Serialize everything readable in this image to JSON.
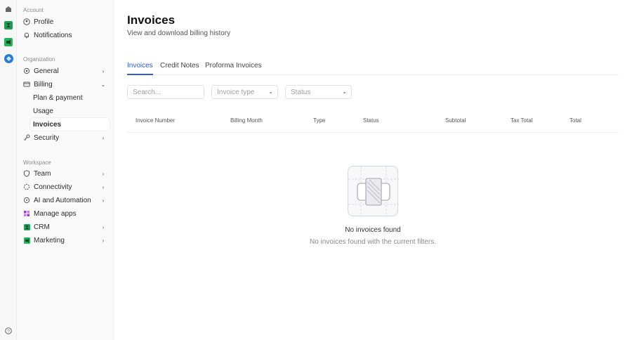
{
  "sidebar": {
    "account_title": "Account",
    "organization_title": "Organization",
    "workspace_title": "Workspace",
    "account_items": [
      {
        "label": "Profile",
        "icon": "user-circle-icon"
      },
      {
        "label": "Notifications",
        "icon": "bell-icon"
      }
    ],
    "organization_items": [
      {
        "label": "General",
        "icon": "gear-icon"
      },
      {
        "label": "Billing",
        "icon": "credit-card-icon"
      },
      {
        "label": "Plan & payment"
      },
      {
        "label": "Usage"
      },
      {
        "label": "Invoices"
      },
      {
        "label": "Security",
        "icon": "key-icon"
      }
    ],
    "workspace_items": [
      {
        "label": "Team",
        "icon": "shield-icon"
      },
      {
        "label": "Connectivity",
        "icon": "connectivity-icon"
      },
      {
        "label": "AI and Automation",
        "icon": "sparkle-icon"
      },
      {
        "label": "Manage apps",
        "icon": "apps-grid-icon"
      },
      {
        "label": "CRM",
        "icon": "crm-app-icon"
      },
      {
        "label": "Marketing",
        "icon": "marketing-app-icon"
      }
    ]
  },
  "page": {
    "title": "Invoices",
    "subtitle": "View and download billing history"
  },
  "tabs": [
    "Invoices",
    "Credit Notes",
    "Proforma Invoices"
  ],
  "filters": {
    "search_placeholder": "Search...",
    "invoice_type": "Invoice type",
    "status": "Status"
  },
  "table": {
    "columns": [
      "Invoice Number",
      "Billing Month",
      "Type",
      "Status",
      "Subtotal",
      "Tax Total",
      "Total"
    ]
  },
  "empty": {
    "title": "No invoices found",
    "description": "No invoices found with the current filters."
  },
  "colors": {
    "accent": "#2f5dd0",
    "crm_green": "#1f9d55",
    "marketing_green": "#24b35a",
    "apps_purple": "#9b3fd4"
  }
}
